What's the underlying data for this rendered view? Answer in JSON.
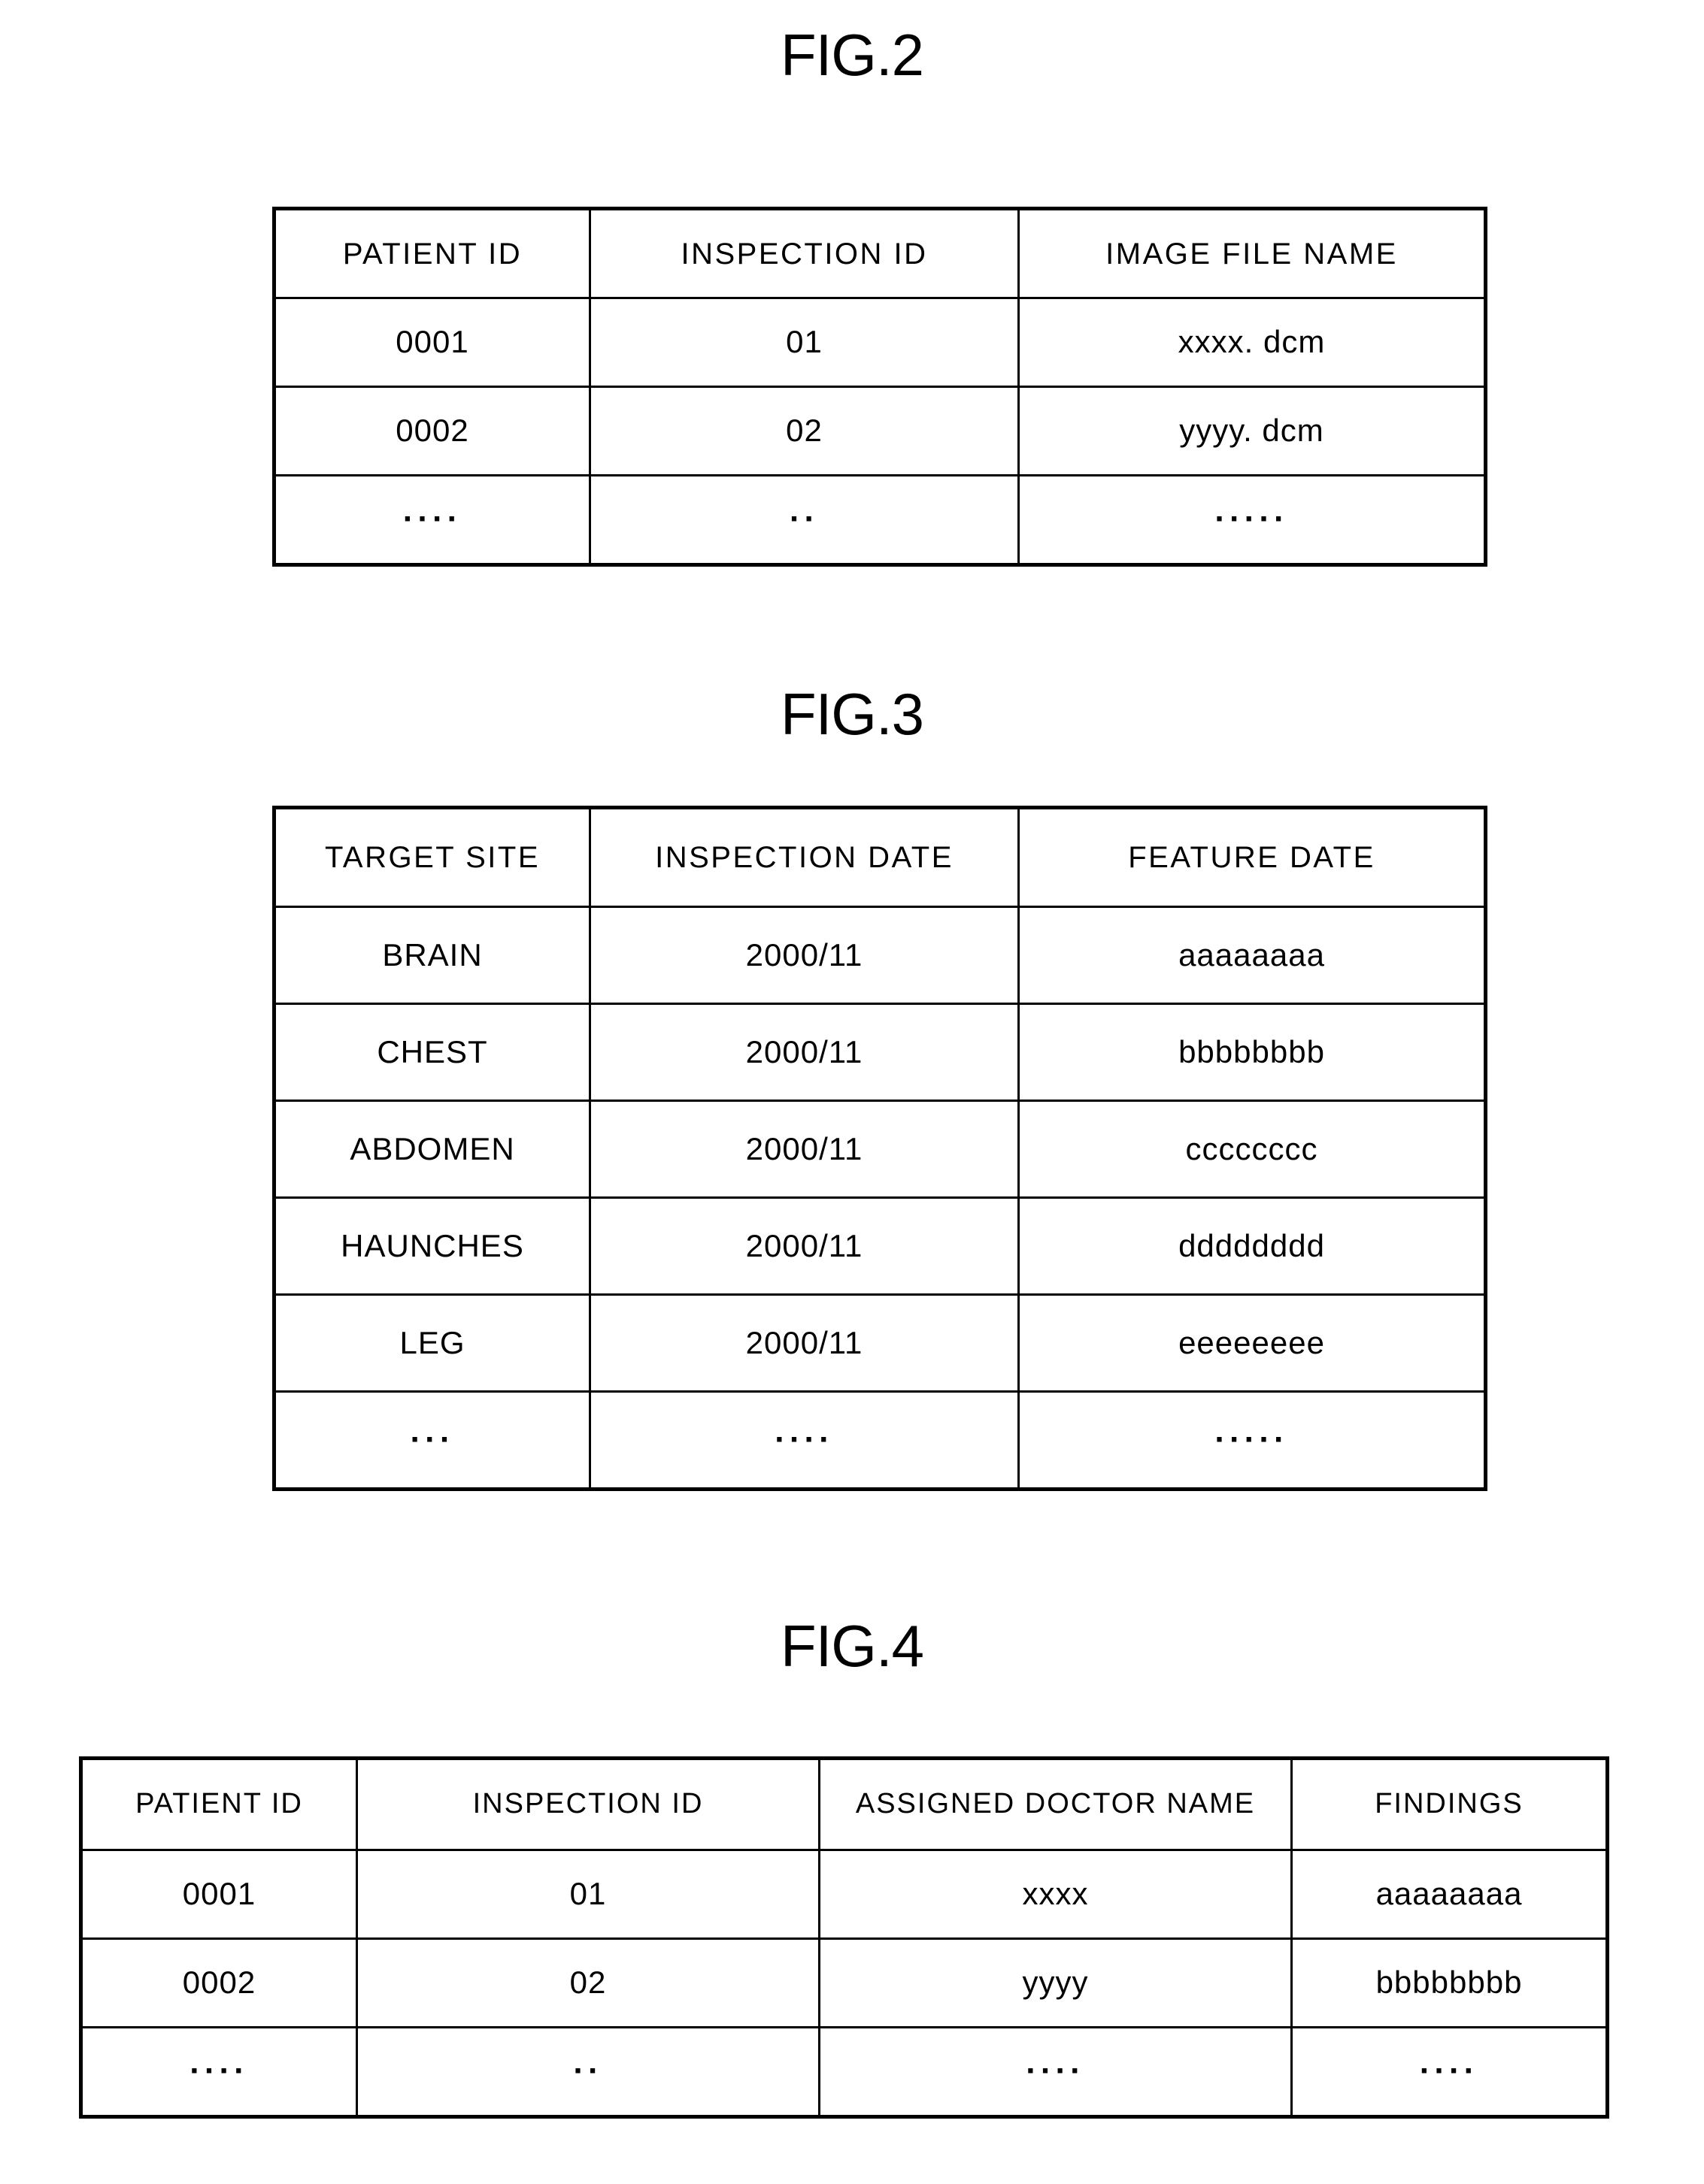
{
  "figures": [
    {
      "title": "FIG.2",
      "headers": [
        "PATIENT ID",
        "INSPECTION ID",
        "IMAGE FILE NAME"
      ],
      "rows": [
        [
          "0001",
          "01",
          "xxxx. dcm"
        ],
        [
          "0002",
          "02",
          "yyyy. dcm"
        ],
        [
          "····",
          "··",
          "·····"
        ]
      ]
    },
    {
      "title": "FIG.3",
      "headers": [
        "TARGET SITE",
        "INSPECTION DATE",
        "FEATURE DATE"
      ],
      "rows": [
        [
          "BRAIN",
          "2000/11",
          "aaaaaaaa"
        ],
        [
          "CHEST",
          "2000/11",
          "bbbbbbbb"
        ],
        [
          "ABDOMEN",
          "2000/11",
          "cccccccc"
        ],
        [
          "HAUNCHES",
          "2000/11",
          "dddddddd"
        ],
        [
          "LEG",
          "2000/11",
          "eeeeeeee"
        ],
        [
          "···",
          "····",
          "·····"
        ]
      ]
    },
    {
      "title": "FIG.4",
      "headers": [
        "PATIENT ID",
        "INSPECTION ID",
        "ASSIGNED DOCTOR NAME",
        "FINDINGS"
      ],
      "rows": [
        [
          "0001",
          "01",
          "xxxx",
          "aaaaaaaa"
        ],
        [
          "0002",
          "02",
          "yyyy",
          "bbbbbbbb"
        ],
        [
          "····",
          "··",
          "····",
          "····"
        ]
      ]
    }
  ],
  "colors": {
    "ink": "#000000",
    "paper": "#ffffff"
  }
}
